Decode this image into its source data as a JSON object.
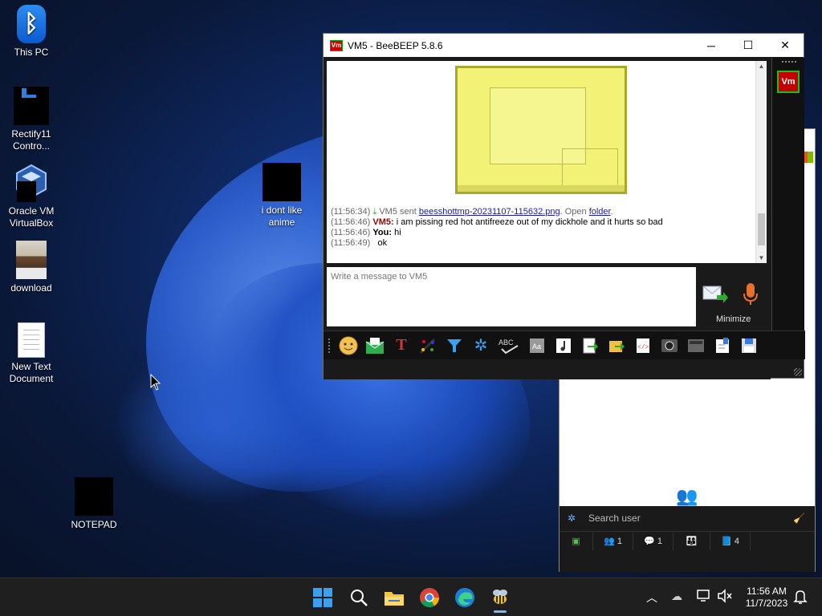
{
  "desktop": {
    "icons": [
      {
        "label": "This PC"
      },
      {
        "label": "Rectify11 Contro..."
      },
      {
        "label": "Oracle VM VirtualBox"
      },
      {
        "label": "download"
      },
      {
        "label": "New Text Document"
      },
      {
        "label": "i dont like anime"
      },
      {
        "label": "NOTEPAD"
      }
    ]
  },
  "chat_window": {
    "title": "VM5 - BeeBEEP 5.8.6",
    "app_icon_text": "Vm",
    "messages": [
      {
        "time": "(11:56:34)",
        "sender": "VM5 sent",
        "link": "beesshottmp-20231107-115632.png",
        "suffix": ". Open",
        "link2": "folder",
        "end": "."
      },
      {
        "time": "(11:56:46)",
        "sender": "VM5:",
        "text": "i am pissing red hot antifreeze out of my dickhole and it hurts so bad"
      },
      {
        "time": "(11:56:46)",
        "sender": "You:",
        "text": "hi"
      },
      {
        "time": "(11:56:49)",
        "sender": "",
        "text": "ok"
      }
    ],
    "input_placeholder": "Write a message to VM5",
    "minimize_label": "Minimize",
    "user_badge": "Vm",
    "toolbar_icons": [
      "emoji-icon",
      "mail-icon",
      "text-format-icon",
      "color-icon",
      "filter-icon",
      "settings-icon",
      "spellcheck-icon",
      "font-icon",
      "music-icon",
      "send-file-icon",
      "send-folder-icon",
      "code-icon",
      "screenshot-icon",
      "screen-record-icon",
      "notes-icon",
      "save-icon"
    ]
  },
  "main_window": {
    "search_placeholder": "Search user",
    "status": [
      {
        "icon": "chat-icon",
        "count": ""
      },
      {
        "icon": "users-icon",
        "count": "1"
      },
      {
        "icon": "chats-icon",
        "count": "1"
      },
      {
        "icon": "groups-icon",
        "count": ""
      },
      {
        "icon": "files-icon",
        "count": "4"
      }
    ]
  },
  "taskbar": {
    "time": "11:56 AM",
    "date": "11/7/2023"
  },
  "colors": {
    "vm_badge": "#c40000",
    "link": "#1a1aa8",
    "sender_vm": "#a00000"
  }
}
